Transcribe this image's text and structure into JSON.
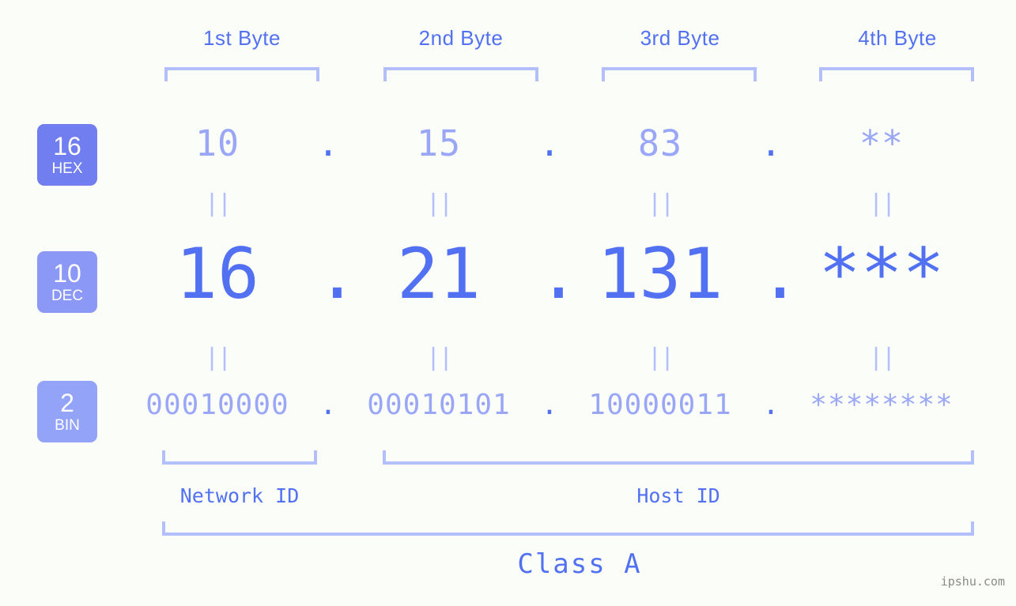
{
  "theme": {
    "background": "#fbfdf8",
    "accent_strong": "#5271f2",
    "accent_light": "#9aa7f7",
    "bracket": "#b3bffa",
    "badge_hex": "#707ef0",
    "badge_dec": "#8b98f5",
    "badge_bin": "#93a4f8",
    "watermark_color": "#8a8a8a"
  },
  "headers": [
    {
      "label": "1st Byte"
    },
    {
      "label": "2nd Byte"
    },
    {
      "label": "3rd Byte"
    },
    {
      "label": "4th Byte"
    }
  ],
  "bases": [
    {
      "number": "16",
      "name": "HEX"
    },
    {
      "number": "10",
      "name": "DEC"
    },
    {
      "number": "2",
      "name": "BIN"
    }
  ],
  "separator": ".",
  "equals_mark": "||",
  "rows": {
    "hex": {
      "base": "16",
      "name": "HEX",
      "values": [
        "10",
        "15",
        "83",
        "**"
      ]
    },
    "dec": {
      "base": "10",
      "name": "DEC",
      "values": [
        "16",
        "21",
        "131",
        "***"
      ]
    },
    "bin": {
      "base": "2",
      "name": "BIN",
      "values": [
        "00010000",
        "00010101",
        "10000011",
        "********"
      ]
    }
  },
  "segments": {
    "network_id": "Network ID",
    "host_id": "Host ID",
    "class": "Class A"
  },
  "watermark": "ipshu.com"
}
